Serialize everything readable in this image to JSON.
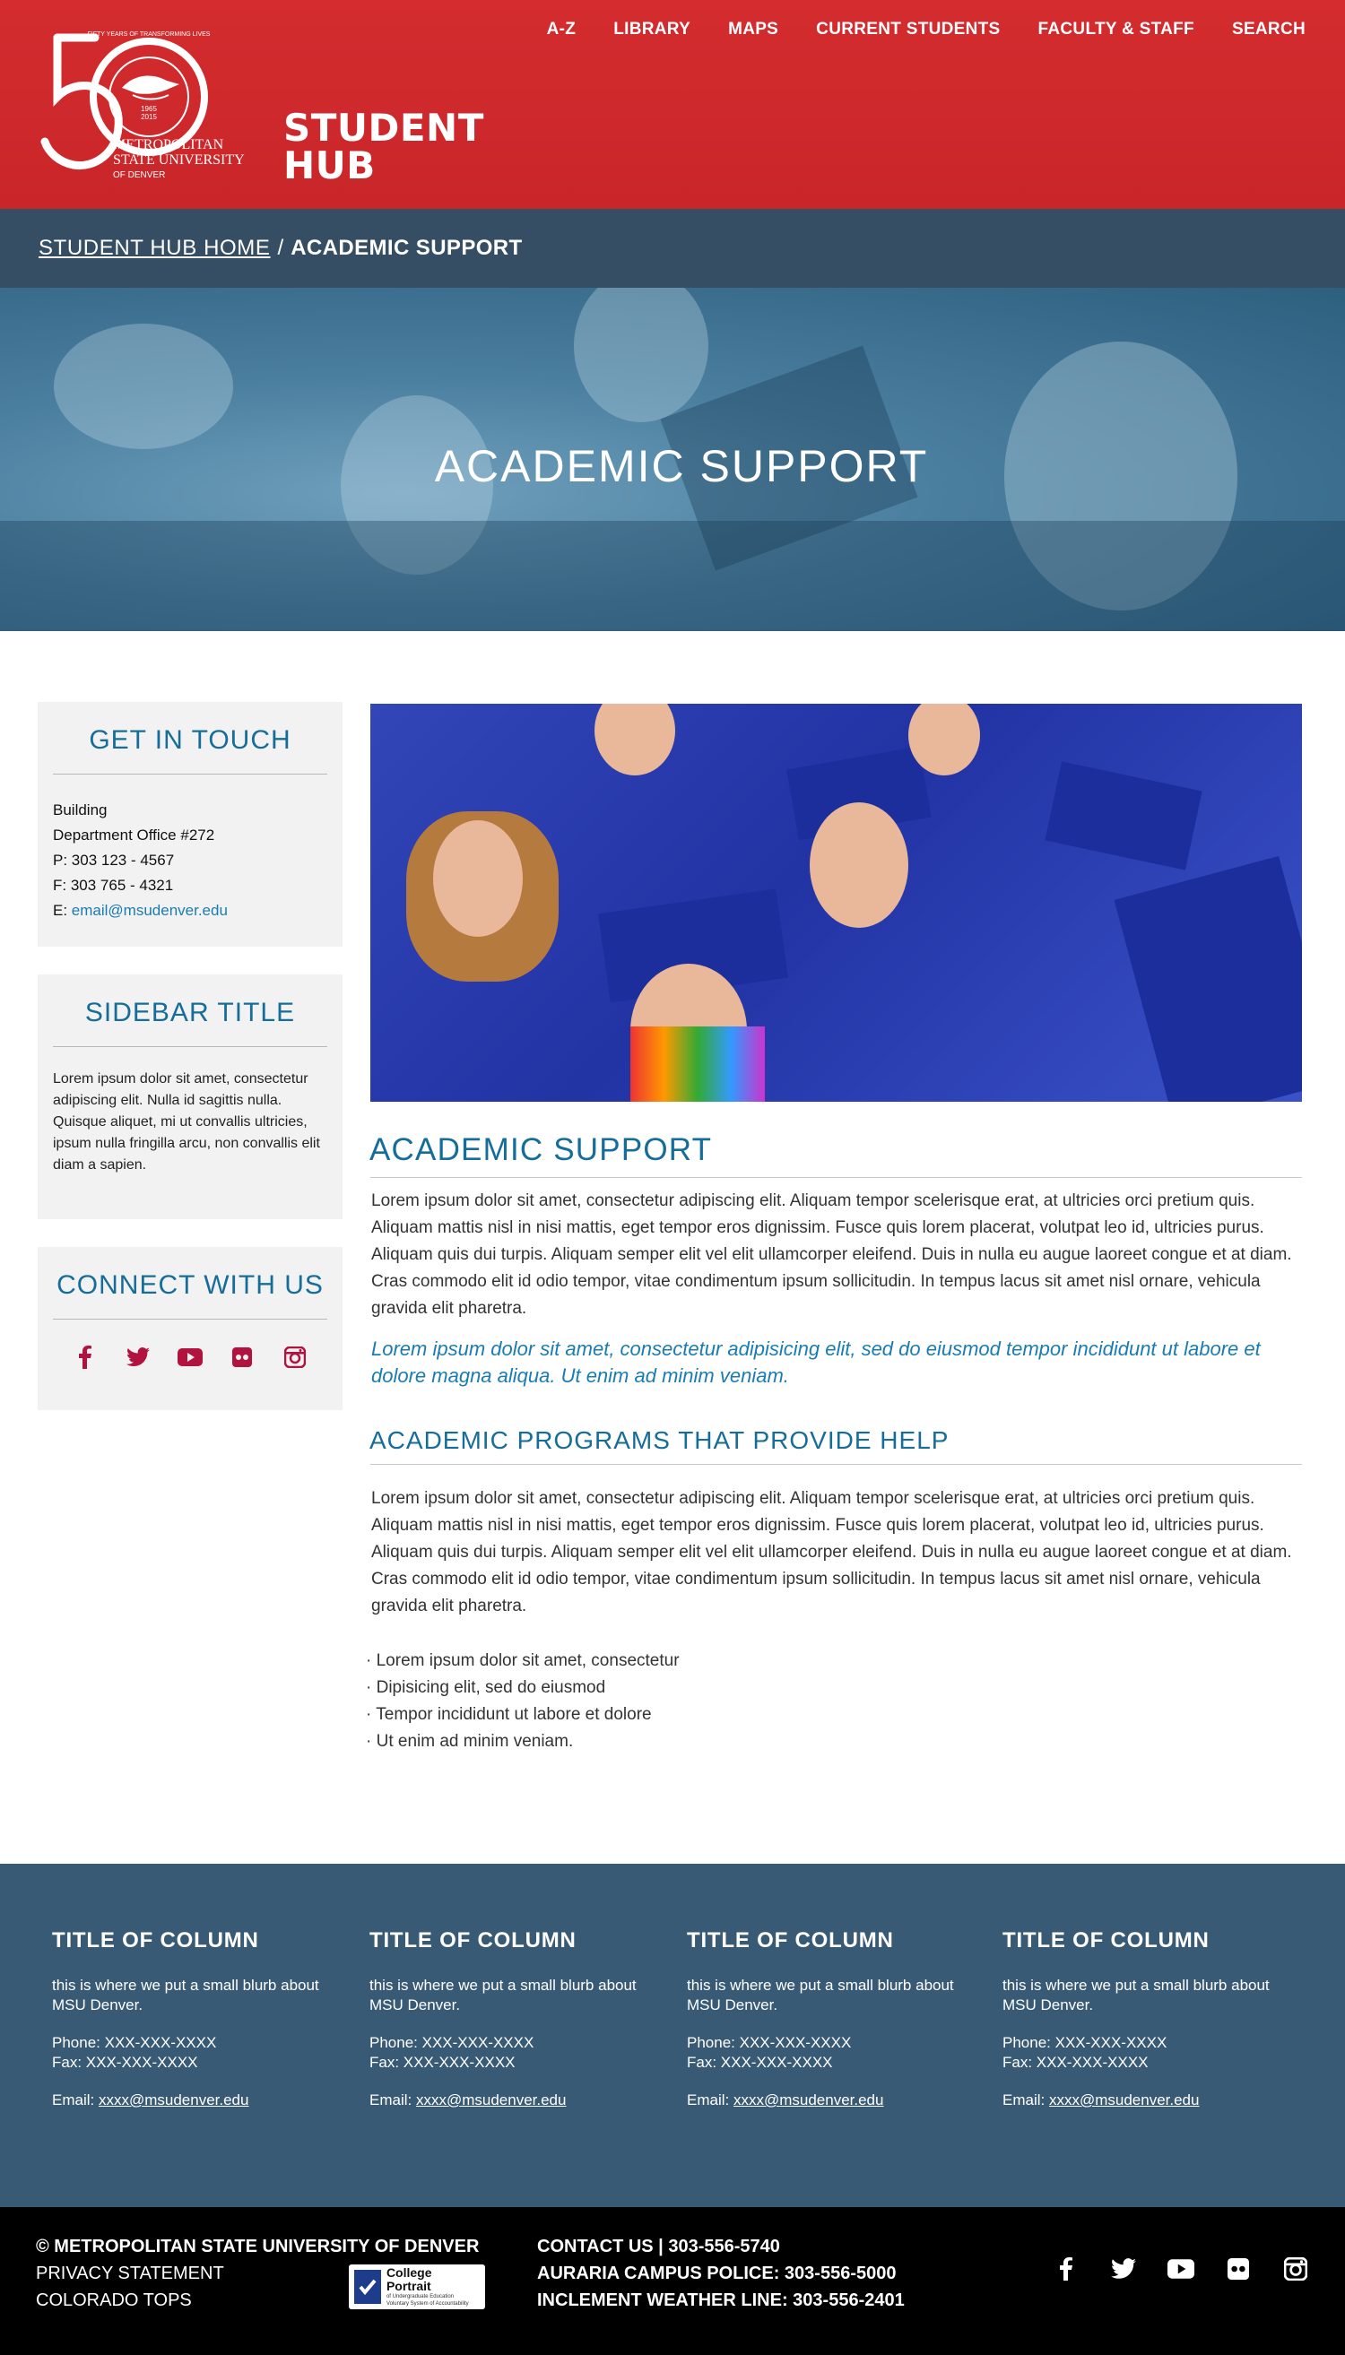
{
  "header": {
    "logo_text": [
      "FIFTY YEARS OF TRANSFORMING LIVES",
      "1965",
      "2015",
      "METROPOLITAN",
      "STATE UNIVERSITY",
      "OF DENVER"
    ],
    "site_title_line1": "STUDENT",
    "site_title_line2": "HUB",
    "nav": [
      "A-Z",
      "LIBRARY",
      "MAPS",
      "CURRENT STUDENTS",
      "FACULTY & STAFF",
      "SEARCH"
    ]
  },
  "breadcrumb": {
    "home": "STUDENT HUB HOME",
    "separator": "/",
    "current": "ACADEMIC SUPPORT"
  },
  "hero": {
    "title": "ACADEMIC SUPPORT"
  },
  "sidebar": {
    "touch": {
      "title": "GET IN TOUCH",
      "building": "Building",
      "office": "Department Office #272",
      "phone": "P: 303 123 - 4567",
      "fax": "F: 303 765 - 4321",
      "email_prefix": "E: ",
      "email": "email@msudenver.edu"
    },
    "generic": {
      "title": "SIDEBAR TITLE",
      "text": "Lorem ipsum dolor sit amet, consectetur adipiscing elit. Nulla id sagittis nulla. Quisque aliquet, mi ut convallis ultricies, ipsum nulla fringilla arcu, non convallis elit diam a sapien."
    },
    "connect": {
      "title": "CONNECT WITH US",
      "icons": [
        "facebook-icon",
        "twitter-icon",
        "youtube-icon",
        "flickr-icon",
        "instagram-icon"
      ]
    }
  },
  "main": {
    "heading": "ACADEMIC SUPPORT",
    "paragraph1": "Lorem ipsum dolor sit amet, consectetur adipiscing elit. Aliquam tempor scelerisque erat, at ultricies orci pretium quis. Aliquam mattis nisl in nisi mattis, eget tempor eros dignissim. Fusce quis lorem placerat, volutpat leo id, ultricies purus. Aliquam quis dui turpis. Aliquam semper elit vel elit ullamcorper eleifend. Duis in nulla eu augue laoreet congue et at diam. Cras commodo elit id odio tempor, vitae condimentum ipsum sollicitudin. In tempus lacus sit amet nisl ornare, vehicula gravida elit pharetra.",
    "quote": "Lorem ipsum dolor sit amet, consectetur adipisicing elit, sed do eiusmod tempor incididunt ut labore et dolore magna aliqua. Ut enim ad minim veniam.",
    "subheading": "ACADEMIC PROGRAMS THAT PROVIDE HELP",
    "paragraph2": "Lorem ipsum dolor sit amet, consectetur adipiscing elit. Aliquam tempor scelerisque erat, at ultricies orci pretium quis. Aliquam mattis nisl in nisi mattis, eget tempor eros dignissim. Fusce quis lorem placerat, volutpat leo id, ultricies purus. Aliquam quis dui turpis. Aliquam semper elit vel elit ullamcorper eleifend. Duis in nulla eu augue laoreet congue et at diam. Cras commodo elit id odio tempor, vitae condimentum ipsum sollicitudin. In tempus lacus sit amet nisl ornare, vehicula gravida elit pharetra.",
    "bullets": [
      "· Lorem ipsum dolor sit amet, consectetur",
      "· Dipisicing elit, sed do eiusmod",
      "· Tempor incididunt ut labore et dolore",
      "· Ut enim ad minim veniam."
    ]
  },
  "footer": {
    "columns": [
      {
        "title": "TITLE OF COLUMN",
        "blurb": "this is where we put a small blurb about MSU Denver.",
        "phone": "Phone: XXX-XXX-XXXX",
        "fax": "Fax: XXX-XXX-XXXX",
        "email_prefix": "Email: ",
        "email": "xxxx@msudenver.edu"
      },
      {
        "title": "TITLE OF COLUMN",
        "blurb": "this is where we put a small blurb about MSU Denver.",
        "phone": "Phone: XXX-XXX-XXXX",
        "fax": "Fax: XXX-XXX-XXXX",
        "email_prefix": "Email: ",
        "email": "xxxx@msudenver.edu"
      },
      {
        "title": "TITLE OF COLUMN",
        "blurb": "this is where we put a small blurb about MSU Denver.",
        "phone": "Phone: XXX-XXX-XXXX",
        "fax": "Fax: XXX-XXX-XXXX",
        "email_prefix": "Email: ",
        "email": "xxxx@msudenver.edu"
      },
      {
        "title": "TITLE OF COLUMN",
        "blurb": "this is where we put a small blurb about MSU Denver.",
        "phone": "Phone: XXX-XXX-XXXX",
        "fax": "Fax: XXX-XXX-XXXX",
        "email_prefix": "Email: ",
        "email": "xxxx@msudenver.edu"
      }
    ],
    "copyright": "© METROPOLITAN STATE UNIVERSITY OF DENVER",
    "privacy": "PRIVACY STATEMENT",
    "tops": "COLORADO TOPS",
    "college_portrait": "College Portrait",
    "college_portrait_sub": "of Undergraduate Education",
    "college_portrait_sub2": "Voluntary System of Accountability",
    "contact": "CONTACT US | 303-556-5740",
    "police": "AURARIA CAMPUS POLICE: 303-556-5000",
    "weather": "INCLEMENT WEATHER LINE: 303-556-2401",
    "icons": [
      "facebook-icon",
      "twitter-icon",
      "youtube-icon",
      "flickr-icon",
      "instagram-icon"
    ]
  },
  "colors": {
    "header_red": "#d42c2f",
    "breadcrumb_bar": "#354e63",
    "heading_blue": "#166d99",
    "link_blue": "#1a7cb3",
    "icon_crimson": "#b2123e",
    "footer_blue": "#385a75",
    "bottom_black": "#000000"
  }
}
